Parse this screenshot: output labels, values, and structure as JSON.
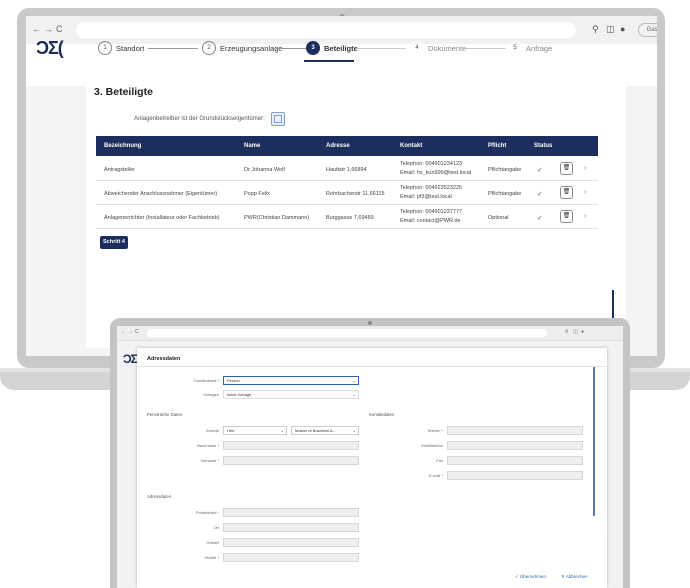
{
  "laptop": {
    "logo": "ϽΣ(",
    "browser": {
      "nav": [
        "←",
        "→",
        "C"
      ],
      "toolbar_icons": [
        "⚲",
        "◫",
        "●"
      ],
      "profile_label": "Gast"
    },
    "steps": [
      {
        "num": "1",
        "label": "Standort",
        "state": "done"
      },
      {
        "num": "2",
        "label": "Erzeugungsanlage",
        "state": "done"
      },
      {
        "num": "3",
        "label": "Beteiligte",
        "state": "active"
      },
      {
        "num": "4",
        "label": "Dokumente",
        "state": "todo"
      },
      {
        "num": "5",
        "label": "Anfrage",
        "state": "todo"
      }
    ],
    "section_title": "3. Beteiligte",
    "checkbox_label": "Anlagenbetreiber ist der Grundstückseigentümer:",
    "table": {
      "headers": [
        "Bezeichnung",
        "Name",
        "Adresse",
        "Kontakt",
        "Pflicht",
        "Status"
      ],
      "rows": [
        {
          "bezeichnung": "Antragsteller",
          "name": "Dr Johanna Wolf",
          "adresse": "Hauttstr 1,66894",
          "kontakt1": "Telephon: 004901234123",
          "kontakt2": "Email: hs_kun999@test.local",
          "pflicht": "Pflichtangabe",
          "status": "✓"
        },
        {
          "bezeichnung": "Abweichender Anschlussnehmer (Eigentümer)",
          "name": "Popp Felix",
          "adresse": "Rohrbacherstr 11,66115",
          "kontakt1": "Telephon: 004923523225",
          "kontakt2": "Email: pf3@test.local",
          "pflicht": "Pflichtangabe",
          "status": "✓"
        },
        {
          "bezeichnung": "Anlagenerrichter (Installateur oder Fachbetrieb)",
          "name": "PWR(Christian Dammann)",
          "adresse": "Burggasse 7,69469",
          "kontakt1": "Telephon: 004901237777",
          "kontakt2": "Email: contact@PWR.de",
          "pflicht": "Optional",
          "status": "✓"
        }
      ]
    },
    "next_button": "Schritt 4"
  },
  "tablet": {
    "logo": "ϽΣ",
    "browser": {
      "nav": [
        "←",
        "→",
        "C"
      ],
      "toolbar_icons": [
        "⚲",
        "◫",
        "●"
      ]
    },
    "modal_title": "Adressdaten",
    "kundenkreis_label": "Kundenkreis *",
    "kundenkreis_value": "Person",
    "vorlagen_label": "Vorlagen",
    "vorlagen_value": "keine Vorlage",
    "section_personal": "Persönliche Daten",
    "section_contact": "Kontaktdaten",
    "section_address": "Adressdaten",
    "anrede_label": "Anrede",
    "anrede_value": "Herr",
    "titel_value": "Master of Business A...",
    "nachname_label": "Nachname *",
    "vorname_label": "Vorname *",
    "telefon_label": "Telefon *",
    "mobil_label": "Mobiltelefon",
    "fax_label": "Fax",
    "email_label": "E-mail *",
    "plz_label": "Postleitzahl *",
    "ort_label": "Ort",
    "ortsteil_label": "Ortsteil",
    "strasse_label": "Straße *",
    "footer_ok": "✓ Übernehmen",
    "footer_cancel": "✕ Abbrechen"
  }
}
